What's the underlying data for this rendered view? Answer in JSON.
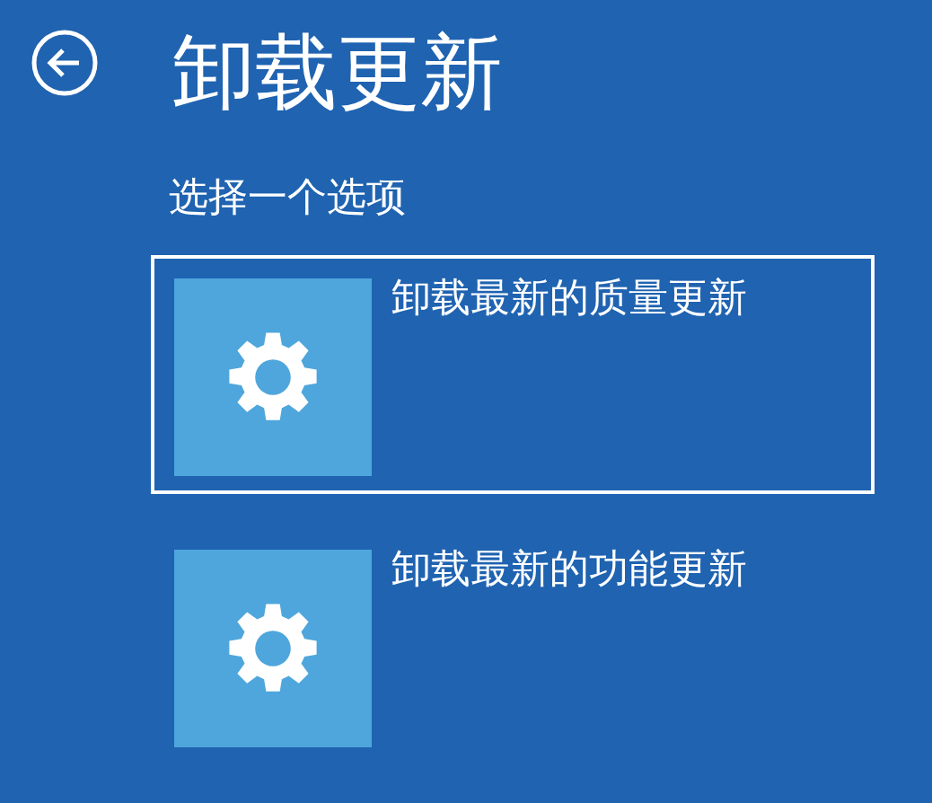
{
  "title": "卸载更新",
  "subtitle": "选择一个选项",
  "options": [
    {
      "label": "卸载最新的质量更新",
      "selected": true
    },
    {
      "label": "卸载最新的功能更新",
      "selected": false
    }
  ]
}
